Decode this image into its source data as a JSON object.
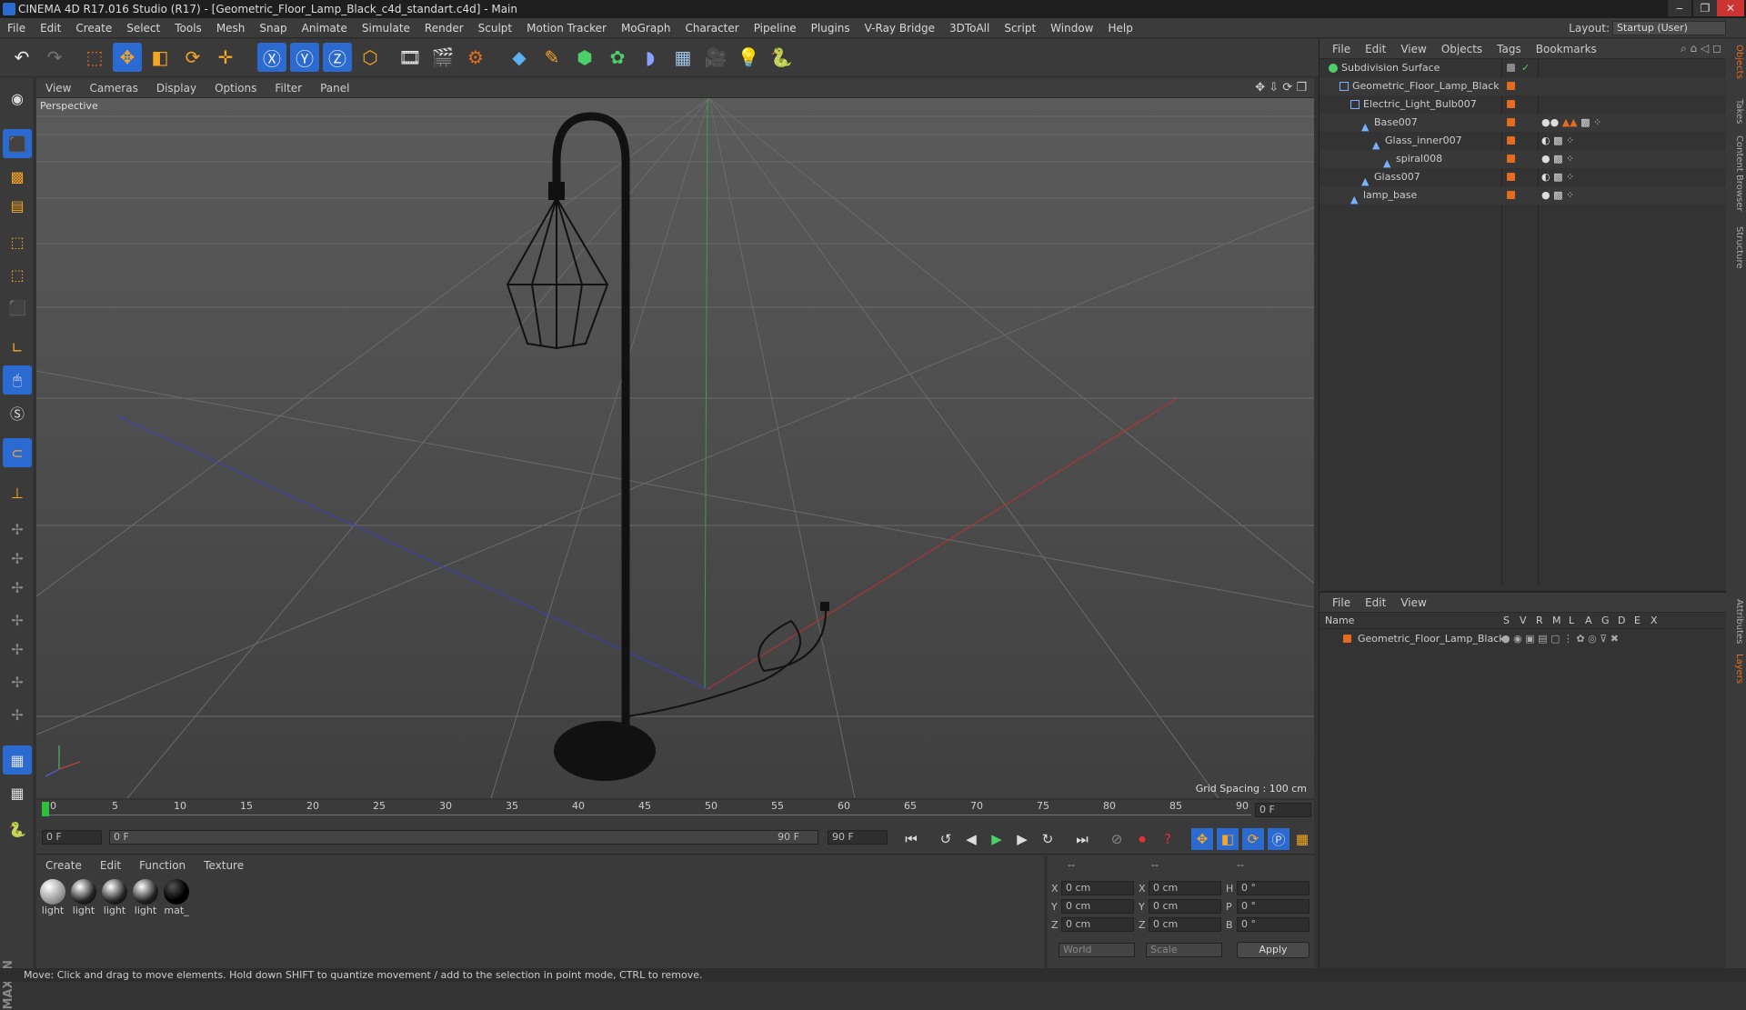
{
  "window": {
    "title": "CINEMA 4D R17.016 Studio (R17) - [Geometric_Floor_Lamp_Black_c4d_standart.c4d] - Main"
  },
  "menubar": {
    "items": [
      "File",
      "Edit",
      "Create",
      "Select",
      "Tools",
      "Mesh",
      "Snap",
      "Animate",
      "Simulate",
      "Render",
      "Sculpt",
      "Motion Tracker",
      "MoGraph",
      "Character",
      "Pipeline",
      "Plugins",
      "V-Ray Bridge",
      "3DToAll",
      "Script",
      "Window",
      "Help"
    ]
  },
  "layout": {
    "label": "Layout:",
    "value": "Startup (User)"
  },
  "viewport": {
    "menu": [
      "View",
      "Cameras",
      "Display",
      "Options",
      "Filter",
      "Panel"
    ],
    "label": "Perspective",
    "grid_spacing": "Grid Spacing : 100 cm"
  },
  "timeline": {
    "ticks": [
      "0",
      "5",
      "10",
      "15",
      "20",
      "25",
      "30",
      "35",
      "40",
      "45",
      "50",
      "55",
      "60",
      "65",
      "70",
      "75",
      "80",
      "85",
      "90"
    ],
    "frame_field": "0 F"
  },
  "playbar": {
    "start": "0 F",
    "range_start": "0 F",
    "range_end": "90 F",
    "end": "90 F"
  },
  "materials": {
    "menu": [
      "Create",
      "Edit",
      "Function",
      "Texture"
    ],
    "items": [
      "light",
      "light",
      "light",
      "light",
      "mat_"
    ]
  },
  "coords": {
    "header": [
      "--",
      "--",
      "--"
    ],
    "rows": [
      {
        "a": "X",
        "av": "0 cm",
        "b": "X",
        "bv": "0 cm",
        "c": "H",
        "cv": "0 °"
      },
      {
        "a": "Y",
        "av": "0 cm",
        "b": "Y",
        "bv": "0 cm",
        "c": "P",
        "cv": "0 °"
      },
      {
        "a": "Z",
        "av": "0 cm",
        "b": "Z",
        "bv": "0 cm",
        "c": "B",
        "cv": "0 °"
      }
    ],
    "world": "World",
    "scale": "Scale",
    "apply": "Apply"
  },
  "object_manager": {
    "menu": [
      "File",
      "Edit",
      "View",
      "Objects",
      "Tags",
      "Bookmarks"
    ],
    "objects": [
      {
        "name": "Subdivision Surface",
        "indent": 0
      },
      {
        "name": "Geometric_Floor_Lamp_Black",
        "indent": 1
      },
      {
        "name": "Electric_Light_Bulb007",
        "indent": 2
      },
      {
        "name": "Base007",
        "indent": 3
      },
      {
        "name": "Glass_inner007",
        "indent": 4
      },
      {
        "name": "spiral008",
        "indent": 5
      },
      {
        "name": "Glass007",
        "indent": 3
      },
      {
        "name": "lamp_base",
        "indent": 2
      }
    ]
  },
  "layer_manager": {
    "menu": [
      "File",
      "Edit",
      "View"
    ],
    "columns": [
      "Name",
      "S",
      "V",
      "R",
      "M",
      "L",
      "A",
      "G",
      "D",
      "E",
      "X"
    ],
    "layer": "Geometric_Floor_Lamp_Black"
  },
  "right_tabs": [
    "Objects",
    "Takes",
    "Content Browser",
    "Structure",
    "Attributes",
    "Layers"
  ],
  "status": "Move: Click and drag to move elements. Hold down SHIFT to quantize movement / add to the selection in point mode, CTRL to remove.",
  "colors": {
    "accent": "#e56b1f",
    "select": "#2b6bd1"
  }
}
